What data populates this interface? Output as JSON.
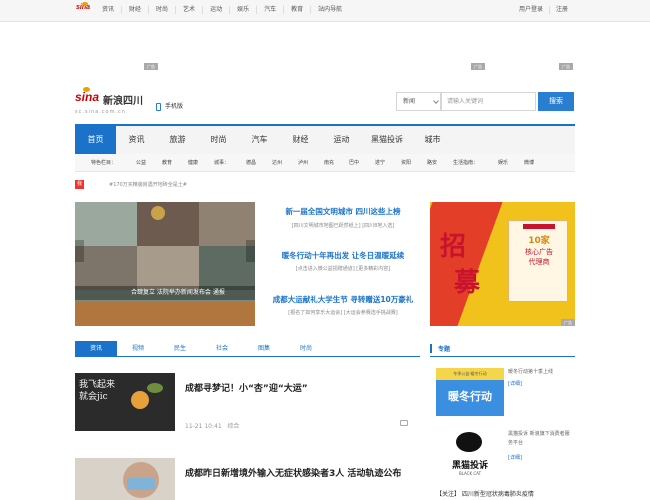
{
  "topbar": {
    "logo": "sina",
    "nav": [
      "资讯",
      "财经",
      "时尚",
      "艺术",
      "运动",
      "娱乐",
      "汽车",
      "教育",
      "站内导航"
    ],
    "right": [
      "用户登录",
      "注册"
    ]
  },
  "ad_tag": "广告",
  "brand": {
    "logo": "sina",
    "name": "新浪四川",
    "domain": "sc.sina.com.cn"
  },
  "mobile_link": "手机版",
  "search": {
    "category": "新闻",
    "placeholder": "请输入关键词",
    "button": "搜索"
  },
  "main_nav": [
    "首页",
    "资讯",
    "旅游",
    "时尚",
    "汽车",
    "财经",
    "运动",
    "黑猫投诉",
    "城市"
  ],
  "sub_nav": [
    "特色栏目：",
    "公益",
    "教育",
    "健康",
    "城事：",
    "德昌",
    "达州",
    "泸州",
    "南充",
    "巴中",
    "遂宁",
    "资阳",
    "路安",
    "生活指南：",
    "娱乐",
    "微博"
  ],
  "hot": {
    "badge": "我要爆料",
    "text": "#170万买精装房遇开地砖全是土#"
  },
  "photo": {
    "caption": "合肆复立 法院举办新闻发布会 通报"
  },
  "headlines": [
    {
      "title": "新一届全国文明城市 四川这些上榜",
      "sub": "[四川文明城市地图已跃然纸上] [四川8地入选]"
    },
    {
      "title": "暖冬行动十年再出发 让冬日温暖延续",
      "sub": "[点击进入微公益捐赠通道] [更多精彩内容]"
    },
    {
      "title": "成都大运献礼大学生节 寻转赠送10万豪礼",
      "sub": "[报名了如何享乐大运会] [大运会参赛选手挑战赛]"
    }
  ],
  "ad": {
    "big1": "招",
    "big2": "募",
    "card_line1": "10家",
    "card_line2": "核心广告",
    "card_line3": "代理商"
  },
  "tabs": [
    "资讯",
    "视频",
    "民生",
    "社会",
    "图集",
    "时尚"
  ],
  "zhuanti": "专题",
  "news": [
    {
      "title": "成都寻梦记！小“杏”迎“大运”",
      "time": "11-21 10:41",
      "category": "综合",
      "thumb_text": "我飞起来\n就会jic"
    },
    {
      "title": "成都昨日新增境外输入无症状感染者3人 活动轨迹公布",
      "time": "",
      "category": "",
      "thumb_text": ""
    }
  ],
  "side_items": [
    {
      "desc": "暖冬行动第十季上线",
      "link": "[详细]",
      "pic_text1": "暖冬行动",
      "pic_text2": "冬季公益·暖冬行动"
    },
    {
      "desc": "黑猫投诉 新浪旗下消费者服务平台",
      "link": "[详细]",
      "pic_text1": "黑猫投诉",
      "pic_text2": "BLACK CAT"
    }
  ],
  "side_link": "【关注】 四川新型冠状病毒肺炎疫情",
  "colors": {
    "brand_blue": "#1a73c9",
    "sina_red": "#cc0000",
    "ad_yellow": "#f1c21b"
  }
}
